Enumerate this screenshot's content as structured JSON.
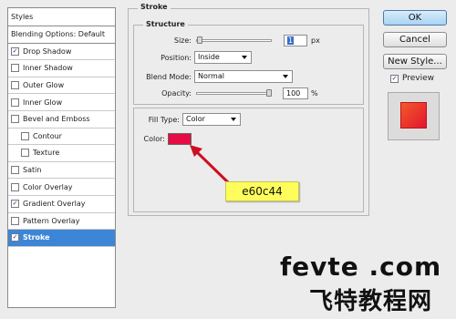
{
  "sidebar": {
    "header": "Styles",
    "blending_options": "Blending Options: Default",
    "items": [
      {
        "label": "Drop Shadow",
        "checked": true
      },
      {
        "label": "Inner Shadow",
        "checked": false
      },
      {
        "label": "Outer Glow",
        "checked": false
      },
      {
        "label": "Inner Glow",
        "checked": false
      },
      {
        "label": "Bevel and Emboss",
        "checked": false
      },
      {
        "label": "Contour",
        "checked": false
      },
      {
        "label": "Texture",
        "checked": false
      },
      {
        "label": "Satin",
        "checked": false
      },
      {
        "label": "Color Overlay",
        "checked": false
      },
      {
        "label": "Gradient Overlay",
        "checked": true
      },
      {
        "label": "Pattern Overlay",
        "checked": false
      },
      {
        "label": "Stroke",
        "checked": true
      }
    ],
    "check_mark": "✓"
  },
  "stroke": {
    "title": "Stroke",
    "structure_title": "Structure",
    "size_label": "Size:",
    "size_value": "1",
    "size_unit": "px",
    "size_slider_fraction": 0.01,
    "position_label": "Position:",
    "position_value": "Inside",
    "blend_mode_label": "Blend Mode:",
    "blend_mode_value": "Normal",
    "opacity_label": "Opacity:",
    "opacity_value": "100",
    "opacity_unit": "%",
    "opacity_slider_fraction": 1.0,
    "fill_type_label": "Fill Type:",
    "fill_type_value": "Color",
    "color_label": "Color:",
    "color_value": "#e60c44"
  },
  "annotation": {
    "text": "e60c44",
    "arrow_color": "#cc1020"
  },
  "buttons": {
    "ok": "OK",
    "cancel": "Cancel",
    "new_style": "New Style...",
    "preview_label": "Preview",
    "preview_checked": true
  },
  "watermark": {
    "latin": "fevte .com",
    "chinese": "飞特教程网"
  }
}
